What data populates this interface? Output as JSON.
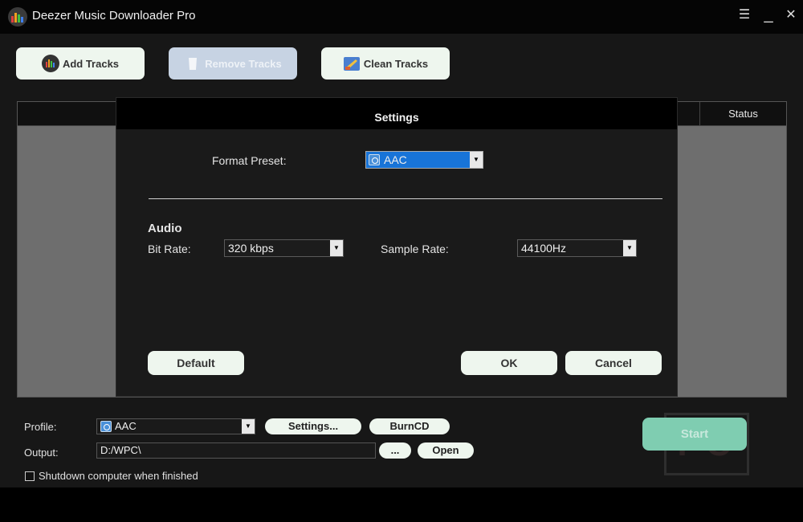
{
  "window": {
    "title": "Deezer Music Downloader Pro",
    "minimize_glyph": "☰",
    "close_glyph": "✕"
  },
  "toolbar": {
    "add_tracks": "Add Tracks",
    "remove_tracks": "Remove Tracks",
    "clean_tracks": "Clean Tracks"
  },
  "track_list": {
    "status_header": "Status"
  },
  "bottom": {
    "profile_label": "Profile:",
    "profile_value": "AAC",
    "settings_button": "Settings...",
    "burncd_button": "BurnCD",
    "output_label": "Output:",
    "output_value": "D:/WPC\\",
    "browse_button": "...",
    "open_button": "Open",
    "shutdown_label": "Shutdown computer when finished",
    "start_button": "Start",
    "watermark": "PC"
  },
  "settings_dialog": {
    "title": "Settings",
    "format_preset_label": "Format Preset:",
    "format_preset_value": "AAC",
    "audio_heading": "Audio",
    "bit_rate_label": "Bit Rate:",
    "bit_rate_value": "320 kbps",
    "sample_rate_label": "Sample Rate:",
    "sample_rate_value": "44100Hz",
    "default_button": "Default",
    "ok_button": "OK",
    "cancel_button": "Cancel"
  },
  "icons": {
    "app": "equalizer-icon",
    "add": "equalizer-icon",
    "remove": "trash-icon",
    "clean": "broom-icon",
    "dropdown": "chevron-down-icon"
  },
  "colors": {
    "accent_blue": "#1874d8",
    "start_green": "#7fcdb1",
    "button_bg": "#eef6ee"
  }
}
